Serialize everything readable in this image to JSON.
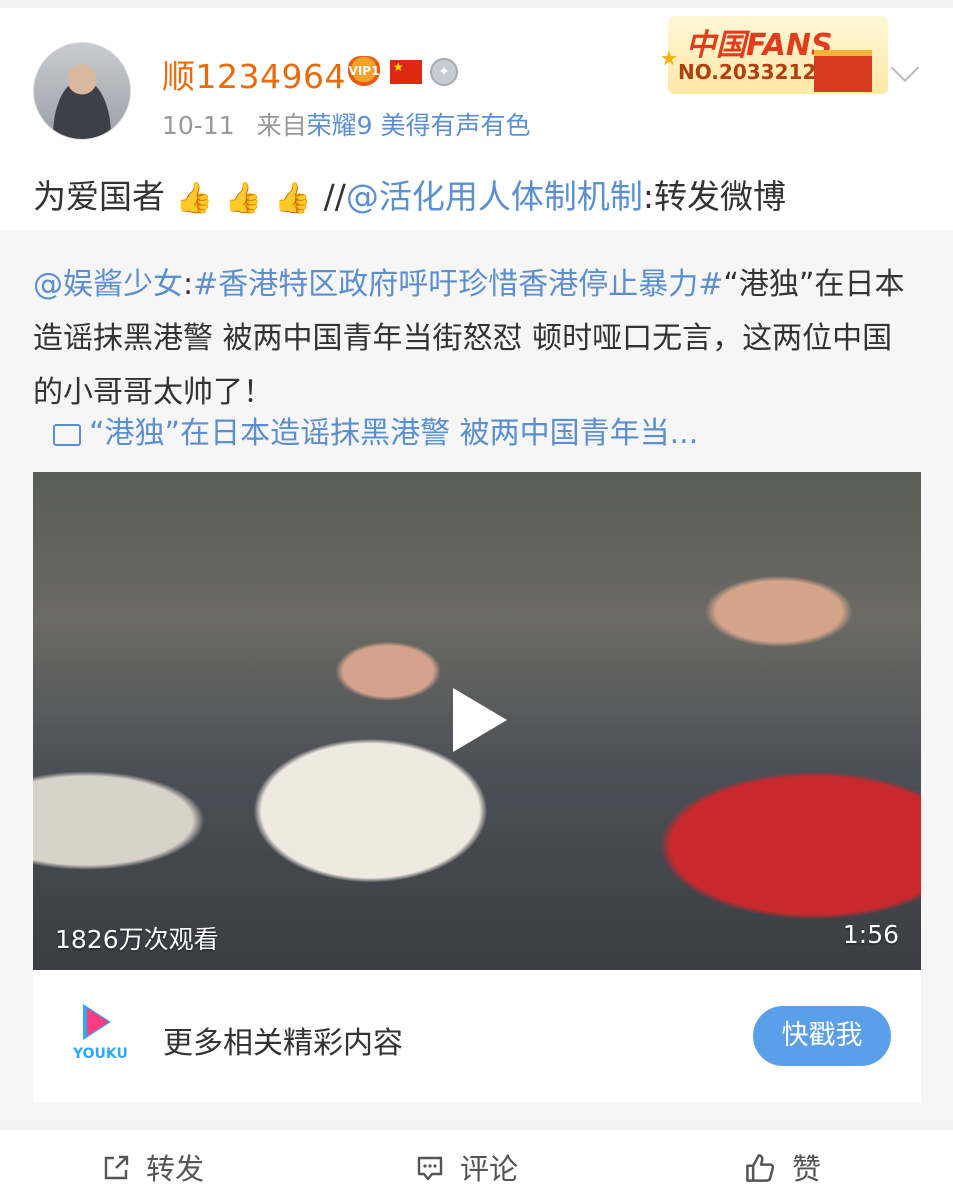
{
  "post": {
    "username": "顺1234964",
    "badges": [
      "vip-heart-icon",
      "china-flag-icon",
      "medal-icon"
    ],
    "vip_label": "VIP1",
    "date": "10-11",
    "source_prefix": "来自",
    "source_device": "荣耀9 美得有声有色",
    "fans_badge": {
      "title": "中国FANS",
      "number": "NO.2033212"
    },
    "text_prefix": "为爱国者",
    "thumbs": [
      "👍",
      "👍",
      "👍"
    ],
    "text_sep": "//",
    "mention": "@活化用人体制机制",
    "text_suffix": ":转发微博"
  },
  "repost": {
    "mention": "@娱酱少女",
    "colon": ":",
    "hashtag": "#香港特区政府呼吁珍惜香港停止暴力#",
    "body": "“港独”在日本造谣抹黑港警 被两中国青年当街怒怼 顿时哑口无言，这两位中国的小哥哥太帅了！",
    "video_link": "“港独”在日本造谣抹黑港警 被两中国青年当...",
    "video": {
      "views": "1826万次观看",
      "duration": "1:56"
    },
    "promo": {
      "logo_text": "YOUKU",
      "text": "更多相关精彩内容",
      "button": "快戳我"
    }
  },
  "actions": [
    {
      "label": "转发",
      "icon": "share-icon"
    },
    {
      "label": "评论",
      "icon": "comment-icon"
    },
    {
      "label": "赞",
      "icon": "like-icon"
    }
  ],
  "colors": {
    "accent": "#5b8fcf",
    "username": "#e86b0c",
    "button": "#5a9fe8"
  }
}
